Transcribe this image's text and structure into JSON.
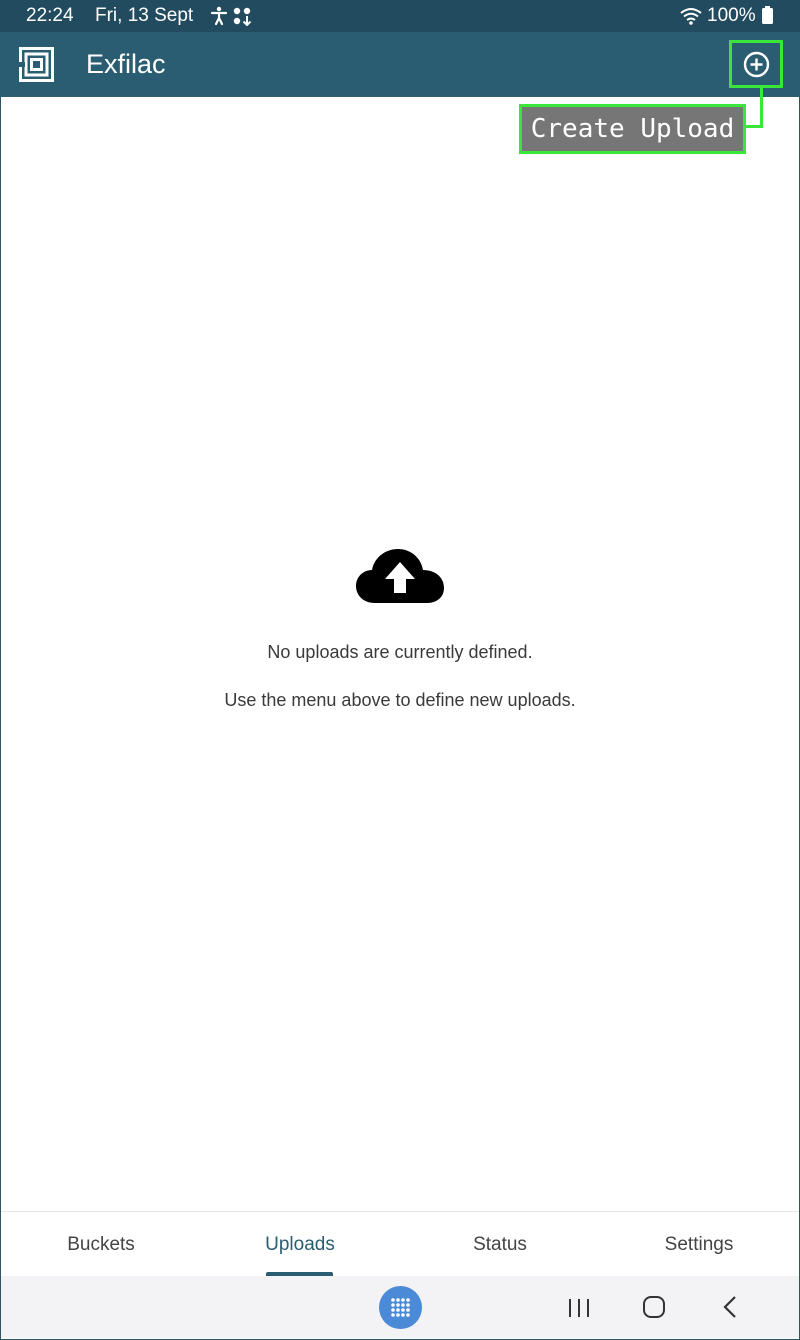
{
  "status_bar": {
    "time": "22:24",
    "date": "Fri, 13 Sept",
    "battery": "100%",
    "icons": [
      "accessibility-icon",
      "dots-icon",
      "wifi-icon",
      "battery-icon"
    ]
  },
  "app_bar": {
    "title": "Exfilac",
    "add_button_icon": "add-circle-icon"
  },
  "callout": {
    "label": "Create Upload"
  },
  "empty_state": {
    "icon": "cloud-upload-icon",
    "line1": "No uploads are currently defined.",
    "line2": "Use the menu above to define new uploads."
  },
  "tabs": [
    {
      "label": "Buckets",
      "active": false
    },
    {
      "label": "Uploads",
      "active": true
    },
    {
      "label": "Status",
      "active": false
    },
    {
      "label": "Settings",
      "active": false
    }
  ],
  "colors": {
    "status_bar": "#224b5f",
    "app_bar": "#2b5d72",
    "highlight": "#39e639",
    "callout_bg": "#767676",
    "apps_button": "#4b8ad6"
  }
}
